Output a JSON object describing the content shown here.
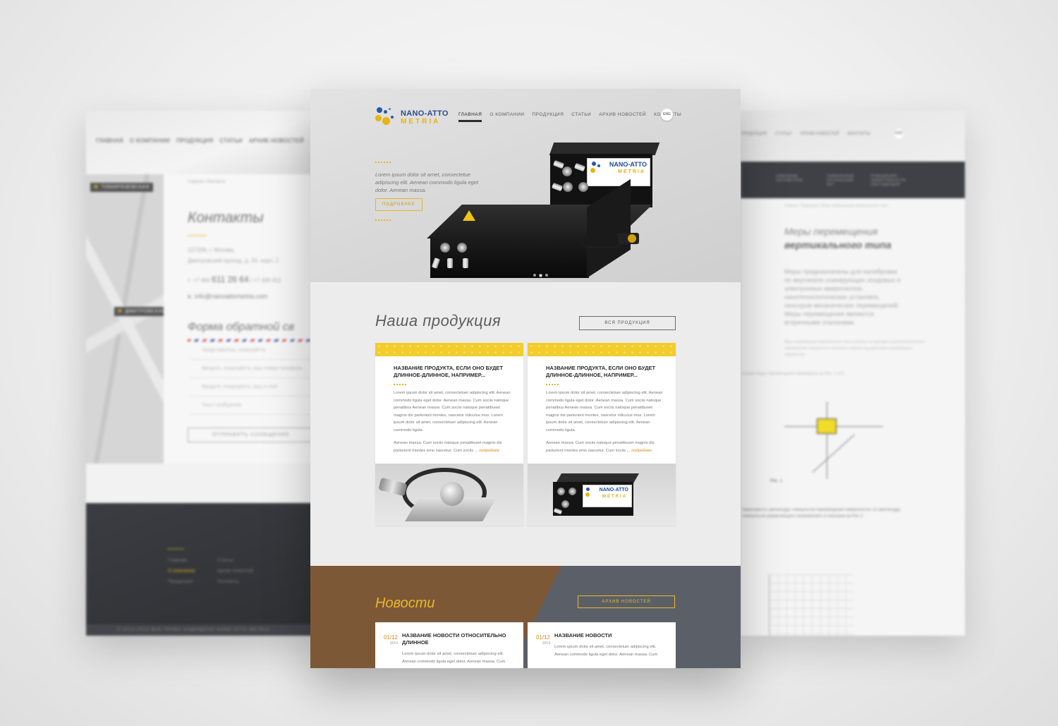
{
  "main": {
    "logo": {
      "line1": "NANO-ATTO",
      "line2": "METRIA"
    },
    "nav": [
      "ГЛАВНАЯ",
      "О КОМПАНИИ",
      "ПРОДУКЦИЯ",
      "СТАТЬИ",
      "АРХИВ НОВОСТЕЙ",
      "КОНТАКТЫ"
    ],
    "nav_active_index": 0,
    "lang": "ENG",
    "hero": {
      "text": "Lorem ipsum dolor sit amet, consectetue adipiscing elit. Aenean commodo ligula eget dolor. Aenean massa.",
      "button": "ПОДРОБНЕЕ",
      "device_label": {
        "line1": "NANO-ATTO",
        "line2": "METRIA"
      },
      "slides": 3,
      "active_slide": 1
    },
    "products": {
      "title": "Наша продукция",
      "all_button": "ВСЯ ПРОДУКЦИЯ",
      "cards": [
        {
          "title": "НАЗВАНИЕ ПРОДУКТА, ЕСЛИ ОНО БУДЕТ ДЛИННОЕ-ДЛИННОЕ, НАПРИМЕР...",
          "text1": "Lorem ipsum dolor sit amet, consectetuer adipiscing elit. Aenean commodo ligula eget dolor. Aenean massa. Cum sociis natoque penatibus Aenean massa. Cum sociis natoque penatibuset magnis dis parturient montes, nascetur ridiculus mus. Lorem ipsum dolor sit amet, consectetuer adipiscing elit. Aenean commodo ligula.",
          "text2": "Aenean massa. Cum sociis natoque penatibuset magnis dis parturient montes emo nascetur. Cum sociis ...",
          "more": "подробнее"
        },
        {
          "title": "НАЗВАНИЕ ПРОДУКТА, ЕСЛИ ОНО БУДЕТ ДЛИННОЕ-ДЛИННОЕ, НАПРИМЕР...",
          "text1": "Lorem ipsum dolor sit amet, consectetuer adipiscing elit. Aenean commodo ligula eget dolor. Aenean massa. Cum sociis natoque penatibus Aenean massa. Cum sociis natoque penatibuset magnis dis parturient montes, nascetur ridiculus mus. Lorem ipsum dolor sit amet, consectetuer adipiscing elit. Aenean commodo ligula.",
          "text2": "Aenean massa. Cum sociis natoque penatibuset magnis dis parturient montes emo nascetur. Cum sociis ...",
          "more": "подробнее",
          "device_label": {
            "line1": "NANO-ATTO",
            "line2": "METRIA"
          }
        }
      ]
    },
    "news": {
      "title": "Новости",
      "archive_button": "АРХИВ НОВОСТЕЙ",
      "items": [
        {
          "date": "01/12",
          "year": "2014",
          "title": "НАЗВАНИЕ НОВОСТИ ОТНОСИТЕЛЬНО ДЛИННОЕ",
          "text": "Lorem ipsum dolor sit amet, consectetuer adipiscing elit. Aenean commodo ligula eget dolor. Aenean massa. Cum"
        },
        {
          "date": "01/12",
          "year": "2014",
          "title": "НАЗВАНИЕ НОВОСТИ",
          "text": "Lorem ipsum dolor sit amet, consectetuer adipiscing elit. Aenean commodo ligula eget dolor. Aenean massa. Cum"
        }
      ]
    }
  },
  "left_page": {
    "nav": [
      "ГЛАВНАЯ",
      "О КОМПАНИИ",
      "ПРОДУКЦИЯ",
      "СТАТЬИ",
      "АРХИВ НОВОСТЕЙ"
    ],
    "map_labels": [
      "ТИМИРЯЗЕВСКАЯ",
      "ДМИТРОВСКАЯ"
    ],
    "breadcrumb": "Главная  /  Контакты",
    "title": "Контакты",
    "address": [
      "127206, г. Москва,",
      "Дмитровский проезд, д. 20, корп. 2"
    ],
    "phone_prefix": "т.  +7 495",
    "phone_number": "611 26 64",
    "phone2": "|   +7 495 611",
    "email": "е.  info@nanoattometria.com",
    "form_title": "Форма обратной св",
    "fields": [
      "Представьтесь, пожалуйста",
      "Введите, пожалуйста, ваш номер телефона",
      "Введите, пожалуйста, ваш e-mail",
      "Текст сообщения"
    ],
    "submit": "ОТПРАВИТЬ СООБЩЕНИЕ",
    "footer_col1": [
      "Главная",
      "О компании",
      "Продукция"
    ],
    "footer_col2": [
      "Статьи",
      "Архив новостей",
      "Контакты"
    ],
    "copyright": "© 2014-2015 ВСЕ ПРАВА ЗАЩИЩЕНЫ NANO-ATTO METRIA"
  },
  "right_page": {
    "nav": [
      "ПРОДУКЦИЯ",
      "СТАТЬИ",
      "АРХИВ НОВОСТЕЙ",
      "КОНТАКТЫ"
    ],
    "lang": "ENG",
    "band_items": [
      "ОПИСАНИЕ ОКТОМЕТРОВ",
      "УНИКАЛЬНЫЙ ОПТИЧЕСКИЙ НЕТ",
      "ПОВЫШЕНИЯ ЭФФЕКТИВНОСТИ СВЕТОДИОДОВ"
    ],
    "breadcrumb": "Главная / Продукция / Меры перемещения вертикального типа",
    "title_line1": "Меры перемещения",
    "title_line2": "вертикального типа",
    "text": "Меры предназначены для калибровки по вертикали сканирующих зондовых и электронных микроскопов, нанотехнологических установок, сенсоров механических перемещений. Меры перемещения являются вторичными эталонами.",
    "small_text": "Меры перемещения вертикального типа основаны на принципе пьезоэлектрического перемещения поверхности эталонного зеркала под действием управляющего напряжения.",
    "diagram_caption": "Схема меры перемещения приведена на Рис. 1 а,б.",
    "fig_label": "Рис. 1",
    "bottom_text": "Зависимость амплитуды «импульсов перемещения поверхности» от амплитуды «импульсов управляющего напряжения» в показана на Рис.2"
  }
}
